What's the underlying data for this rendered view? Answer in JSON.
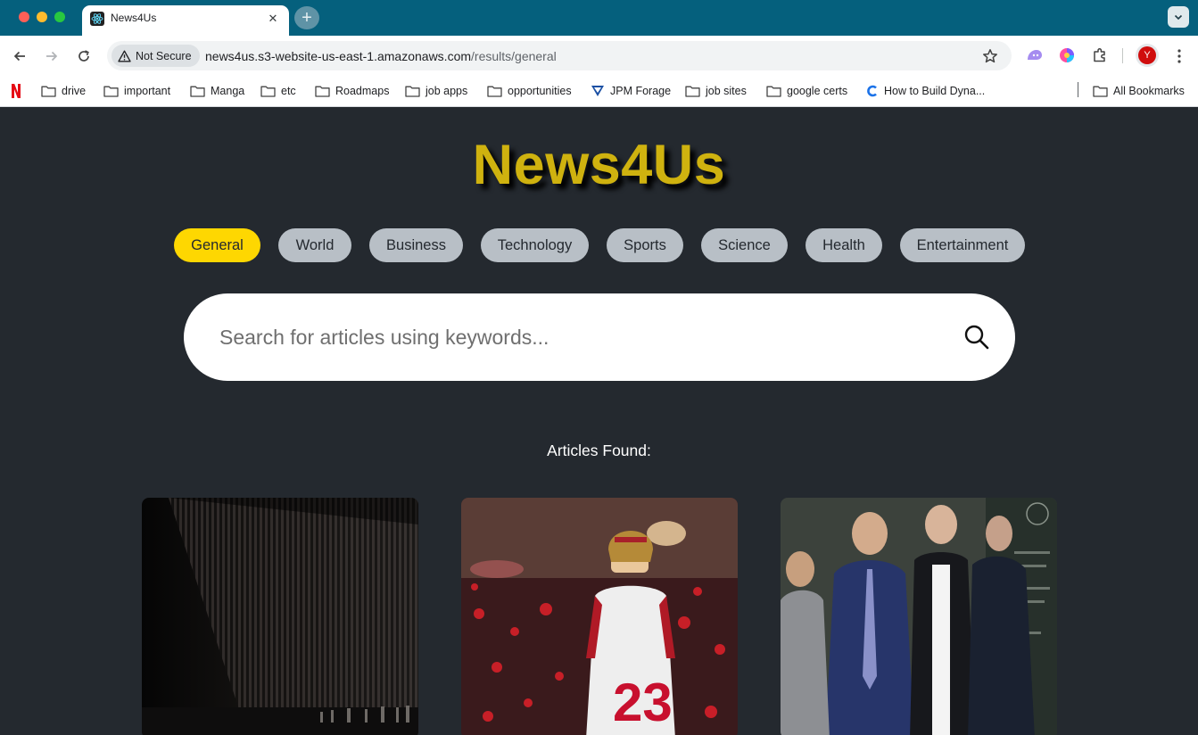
{
  "browser": {
    "tab_title": "News4Us",
    "security_label": "Not Secure",
    "url_domain": "news4us.s3-website-us-east-1.amazonaws.com",
    "url_path": "/results/general",
    "avatar_letter": "Y",
    "bookmarks": [
      {
        "label": "drive",
        "icon": "folder-icon"
      },
      {
        "label": "important",
        "icon": "folder-icon"
      },
      {
        "label": "Manga",
        "icon": "folder-icon"
      },
      {
        "label": "etc",
        "icon": "folder-icon"
      },
      {
        "label": "Roadmaps",
        "icon": "folder-icon"
      },
      {
        "label": "job apps",
        "icon": "folder-icon"
      },
      {
        "label": "opportunities",
        "icon": "folder-icon"
      },
      {
        "label": "JPM Forage",
        "icon": "forage-icon"
      },
      {
        "label": "job sites",
        "icon": "folder-icon"
      },
      {
        "label": "google certs",
        "icon": "folder-icon"
      },
      {
        "label": "How to Build Dyna...",
        "icon": "c-logo-icon"
      }
    ],
    "all_bookmarks_label": "All Bookmarks"
  },
  "site": {
    "logo": "News4Us",
    "logo_color": "#cfb20f",
    "accent": "#fed701",
    "categories": [
      "General",
      "World",
      "Business",
      "Technology",
      "Sports",
      "Science",
      "Health",
      "Entertainment"
    ],
    "active_category": "General",
    "search_placeholder": "Search for articles using keywords...",
    "results_heading": "Articles Found:"
  },
  "articles": [
    {
      "image": "border-fence-photo"
    },
    {
      "image": "football-player-photo"
    },
    {
      "image": "courthouse-people-photo"
    }
  ]
}
